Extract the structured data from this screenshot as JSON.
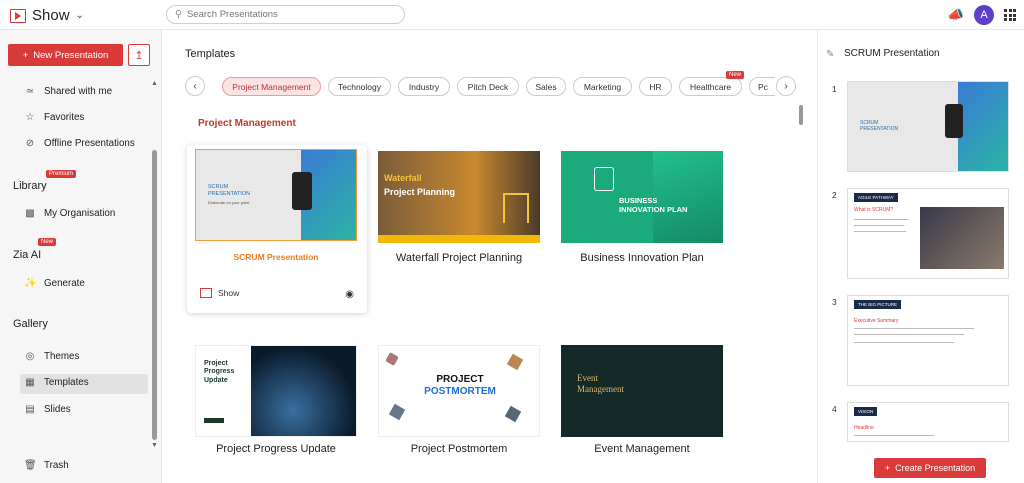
{
  "app": {
    "name": "Show"
  },
  "search": {
    "placeholder": "Search Presentations"
  },
  "user": {
    "initial": "A"
  },
  "sidebar": {
    "new_label": "New Presentation",
    "items_top": [
      {
        "label": "Shared with me",
        "icon": "share-icon"
      },
      {
        "label": "Favorites",
        "icon": "star-icon"
      },
      {
        "label": "Offline Presentations",
        "icon": "offline-icon"
      }
    ],
    "library": {
      "heading": "Library",
      "badge": "Premium",
      "items": [
        {
          "label": "My Organisation",
          "icon": "org-icon"
        }
      ]
    },
    "zia": {
      "heading": "Zia AI",
      "badge": "New",
      "items": [
        {
          "label": "Generate",
          "icon": "magic-icon"
        }
      ]
    },
    "gallery": {
      "heading": "Gallery",
      "items": [
        {
          "label": "Themes",
          "icon": "palette-icon"
        },
        {
          "label": "Templates",
          "icon": "templates-icon"
        },
        {
          "label": "Slides",
          "icon": "slides-icon"
        }
      ]
    },
    "trash": "Trash"
  },
  "main": {
    "title": "Templates",
    "chips": [
      "Project Management",
      "Technology",
      "Industry",
      "Pitch Deck",
      "Sales",
      "Marketing",
      "HR",
      "Healthcare",
      "Pc"
    ],
    "healthcare_badge": "New",
    "section": "Project Management",
    "cards": [
      {
        "label": "SCRUM Presentation",
        "thumb_title": "SCRUM PRESENTATION",
        "thumb_sub": "Elaborate on your point"
      },
      {
        "label": "Waterfall Project Planning",
        "thumb_title": "Waterfall",
        "thumb_title2": "Project Planning"
      },
      {
        "label": "Business Innovation Plan",
        "thumb_title": "BUSINESS INNOVATION PLAN"
      },
      {
        "label": "Project Progress Update",
        "thumb_title": "Project Progress Update"
      },
      {
        "label": "Project Postmortem",
        "thumb_title": "PROJECT",
        "thumb_title2": "POSTMORTEM"
      },
      {
        "label": "Event Management",
        "thumb_title": "Event Management"
      }
    ],
    "show_label": "Show"
  },
  "right": {
    "title": "SCRUM Presentation",
    "slides": [
      {
        "num": "1",
        "title": "SCRUM PRESENTATION"
      },
      {
        "num": "2",
        "title": "AGILE PATHWAY",
        "sub": "What is SCRUM?"
      },
      {
        "num": "3",
        "title": "THE BIG PICTURE",
        "sub": "Executive Summary"
      },
      {
        "num": "4",
        "title": "VISION",
        "sub": "Headline"
      }
    ],
    "create_label": "Create Presentation"
  },
  "colors": {
    "accent": "#d93a3a",
    "avatar": "#5b3fc6"
  }
}
